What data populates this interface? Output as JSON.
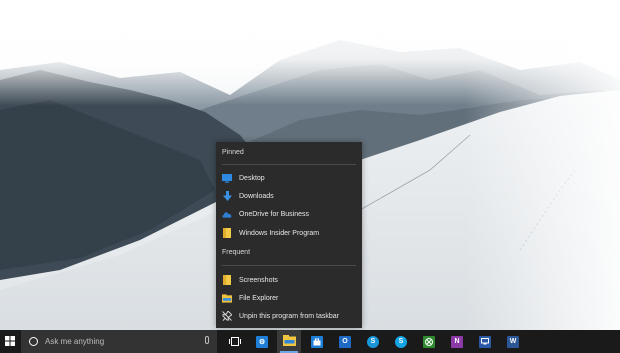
{
  "desktop": {
    "wallpaper": "snowy-mountain-landscape"
  },
  "jumplist": {
    "pinned_header": "Pinned",
    "pinned_items": [
      {
        "label": "Desktop",
        "icon": "desktop-icon"
      },
      {
        "label": "Downloads",
        "icon": "download-arrow-icon"
      },
      {
        "label": "OneDrive for Business",
        "icon": "onedrive-icon"
      },
      {
        "label": "Windows Insider Program",
        "icon": "folder-icon"
      }
    ],
    "frequent_header": "Frequent",
    "frequent_items": [
      {
        "label": "Screenshots",
        "icon": "folder-icon"
      },
      {
        "label": "File Explorer",
        "icon": "file-explorer-icon"
      },
      {
        "label": "Unpin this program from taskbar",
        "icon": "unpin-icon"
      }
    ]
  },
  "taskbar": {
    "search_placeholder": "Ask me anything",
    "apps": [
      {
        "name": "settings",
        "color": "#1e7fd8",
        "active": false
      },
      {
        "name": "file-explorer",
        "color": "#f2c640",
        "active": true
      },
      {
        "name": "store",
        "color": "#1e7fd8",
        "active": false
      },
      {
        "name": "outlook",
        "color": "#1f6ac2",
        "active": false
      },
      {
        "name": "skype-for-business",
        "color": "#1a95d8",
        "active": false
      },
      {
        "name": "skype",
        "color": "#16a3e3",
        "active": false
      },
      {
        "name": "xbox",
        "color": "#2f8a2f",
        "active": false
      },
      {
        "name": "onenote",
        "color": "#8b3aa8",
        "active": false
      },
      {
        "name": "remote-app",
        "color": "#2a5aa8",
        "active": false
      },
      {
        "name": "word",
        "color": "#2b5797",
        "active": false
      }
    ]
  }
}
